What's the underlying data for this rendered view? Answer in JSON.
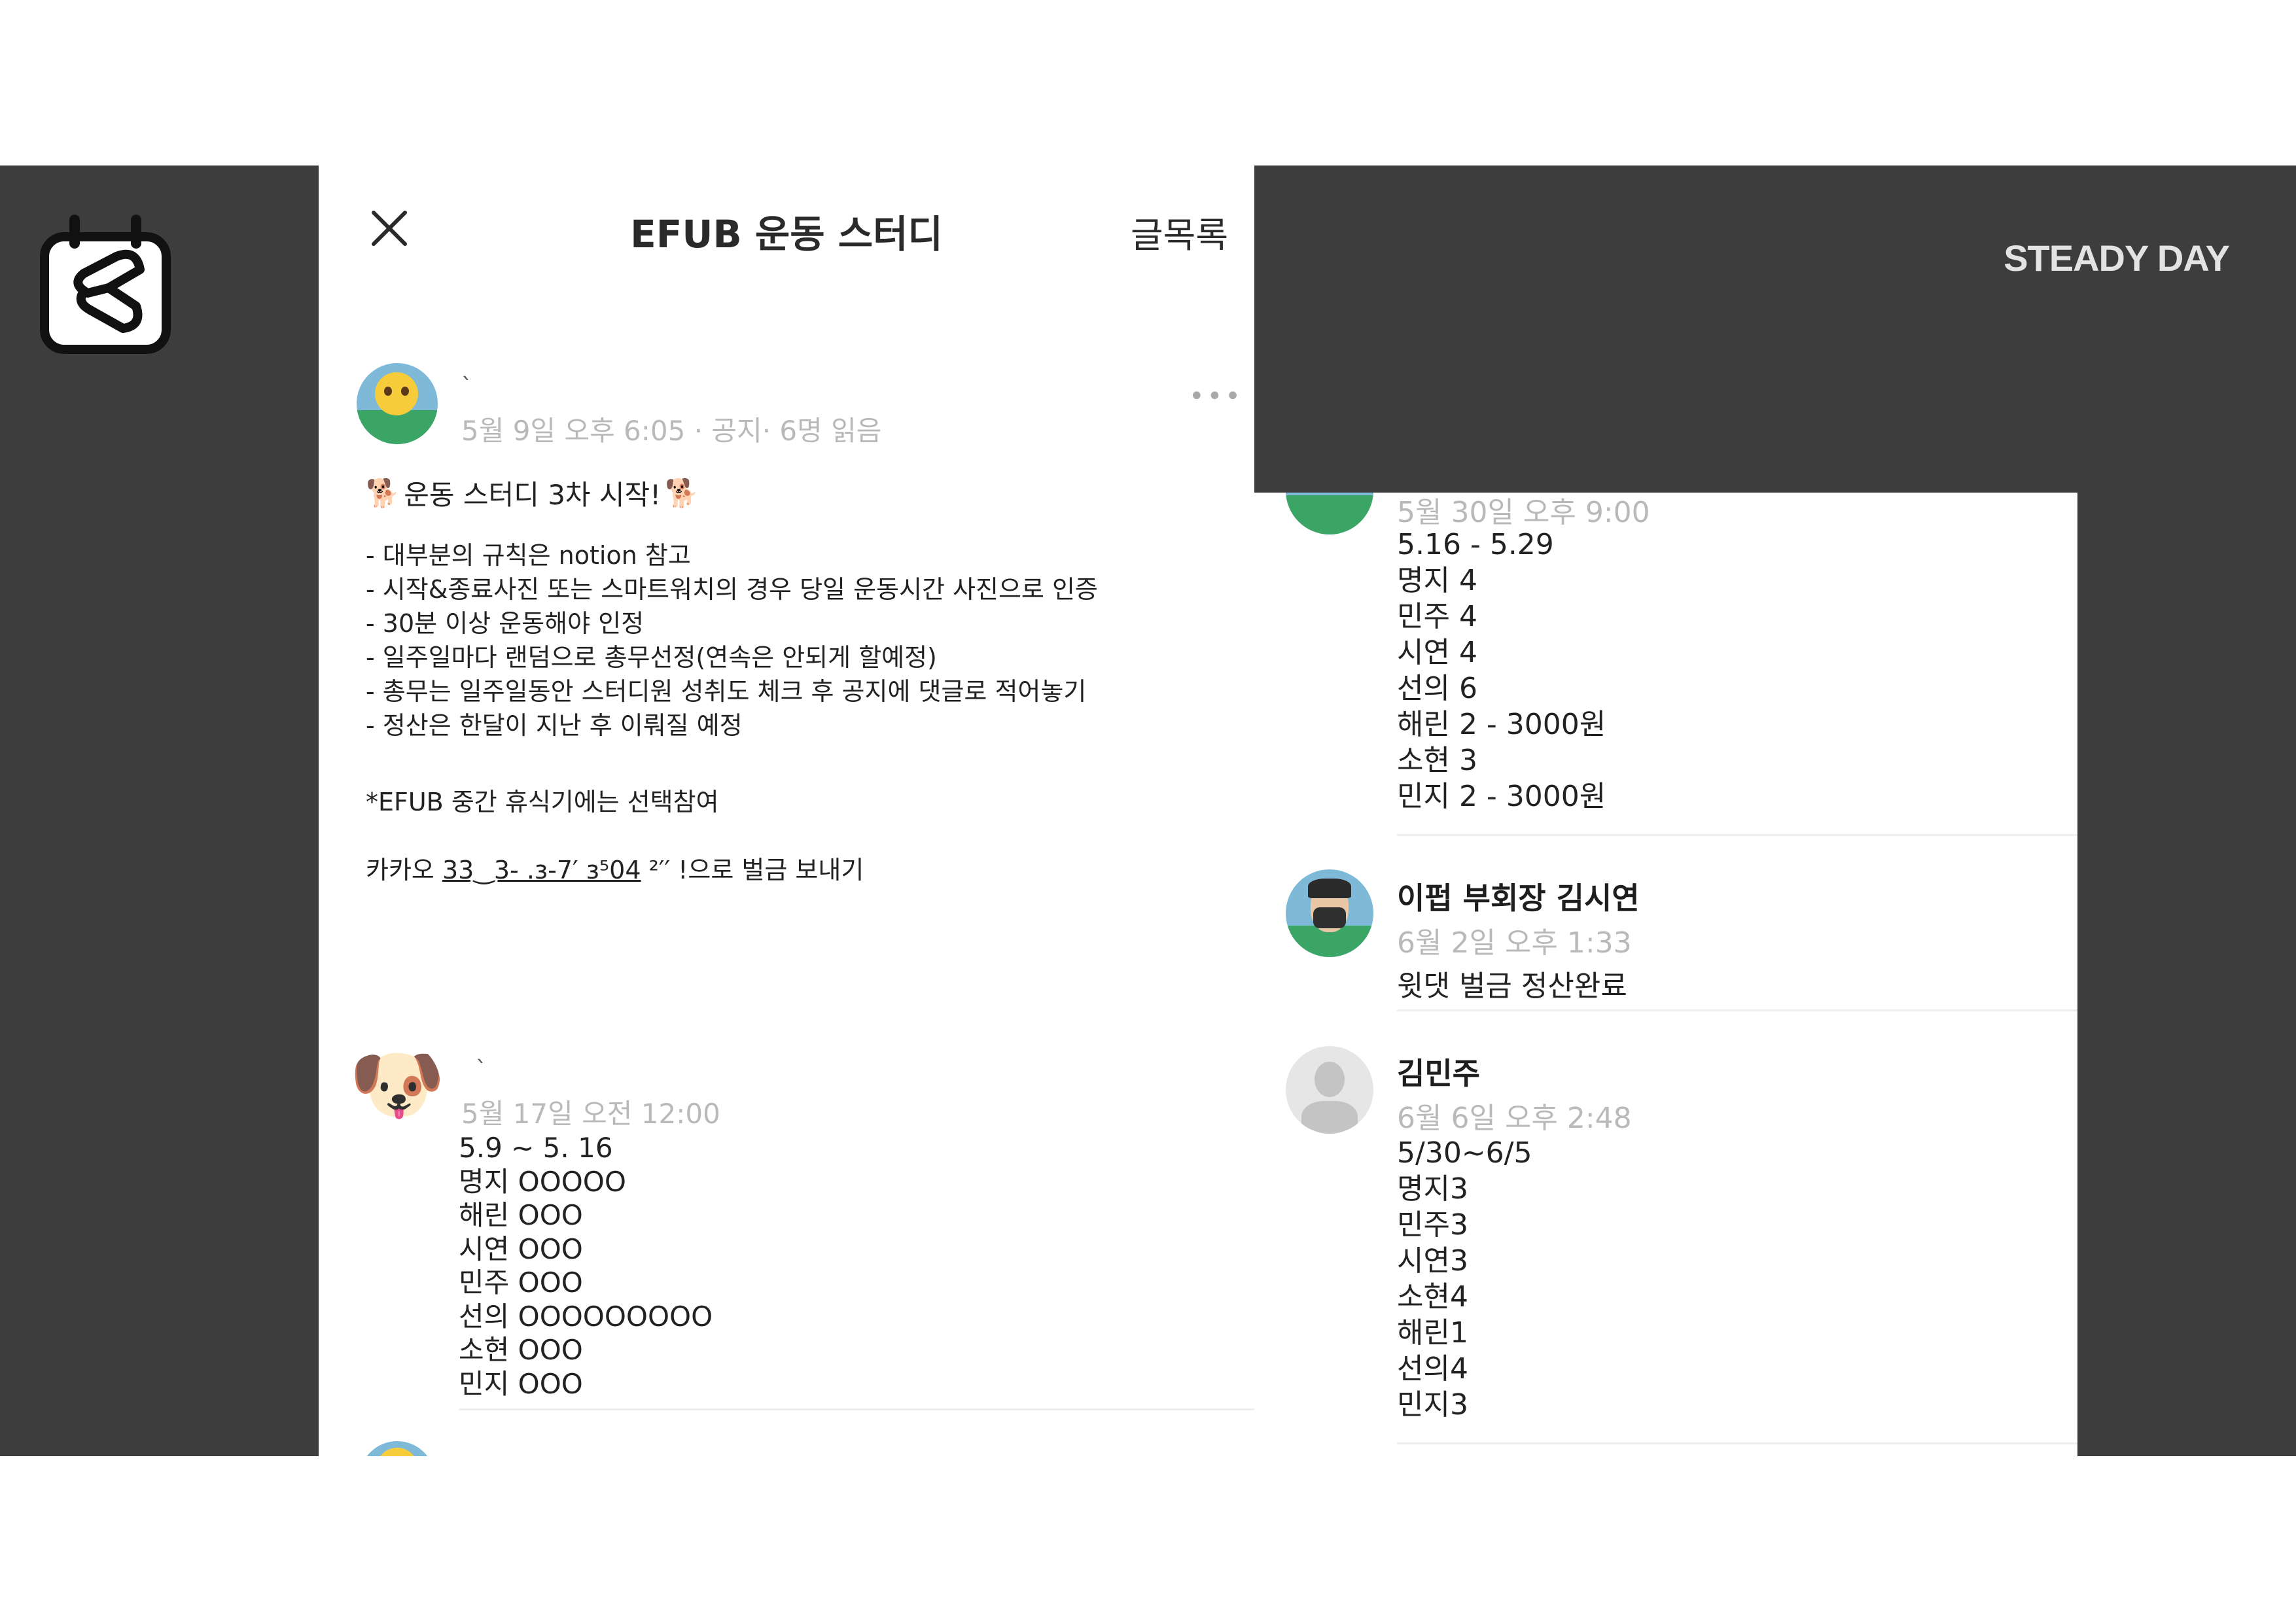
{
  "brand": "STEADY DAY",
  "left_panel": {
    "header": {
      "title": "EFUB 운동 스터디",
      "list_label": "글목록"
    },
    "post1": {
      "author": "`",
      "meta": "5월 9일 오후 6:05 · 공지· 6명 읽음",
      "more": "•••",
      "title": "운동 스터디 3차 시작!",
      "title_emoji": "🐕",
      "lines": [
        "- 대부분의 규칙은 notion 참고",
        "- 시작&종료사진 또는 스마트워치의 경우 당일 운동시간 사진으로 인증",
        "- 30분 이상 운동해야 인정",
        "- 일주일마다 랜덤으로 총무선정(연속은 안되게 할예정)",
        "- 총무는 일주일동안 스터디원 성취도 체크 후 공지에 댓글로 적어놓기",
        "- 정산은 한달이 지난 후 이뤄질 예정"
      ],
      "note": "*EFUB 중간 휴식기에는 선택참여",
      "account_prefix": "카카오 ",
      "account_number": "33‿3‐ .ɜ‐7′  ɜ⁵04",
      "account_suffix": " ²′′   !으로 벌금 보내기"
    },
    "post2": {
      "author": "`",
      "meta": "5월 17일 오전 12:00",
      "avatar_emoji": "🐶",
      "lines": [
        "5.9 ~ 5. 16",
        "명지 OOOOO",
        "해린 OOO",
        "시연 OOO",
        "민주 OOO",
        "선의 OOOOOOOOO",
        "소현 OOO",
        "민지 OOO"
      ]
    }
  },
  "right_panel": {
    "comment1": {
      "meta": "5월 30일 오후 9:00",
      "lines": [
        "5.16 - 5.29",
        "명지 4",
        "민주 4",
        "시연 4",
        "선의 6",
        "해린 2 - 3000원",
        "소현 3",
        "민지 2 - 3000원"
      ]
    },
    "comment2": {
      "name": "이펍 부회장 김시연",
      "meta": "6월 2일 오후 1:33",
      "text": "윗댓 벌금 정산완료"
    },
    "comment3": {
      "name": "김민주",
      "meta": "6월 6일 오후 2:48",
      "lines": [
        "5/30~6/5",
        "명지3",
        "민주3",
        "시연3",
        "소현4",
        "해린1",
        "선의4",
        "민지3"
      ]
    }
  }
}
